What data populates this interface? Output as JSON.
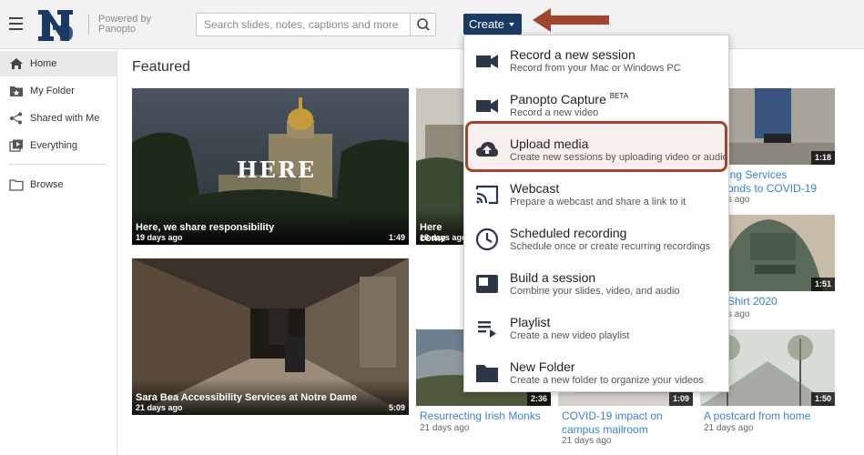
{
  "header": {
    "logo_text": "ND",
    "powered_line1": "Powered by",
    "powered_line2": "Panopto",
    "search_placeholder": "Search slides, notes, captions and more",
    "create_label": "Create"
  },
  "sidebar": {
    "items": [
      {
        "label": "Home",
        "icon": "home-icon",
        "active": true
      },
      {
        "label": "My Folder",
        "icon": "folder-star-icon"
      },
      {
        "label": "Shared with Me",
        "icon": "share-icon"
      },
      {
        "label": "Everything",
        "icon": "video-library-icon"
      },
      {
        "label": "Browse",
        "icon": "folder-icon"
      }
    ]
  },
  "main": {
    "heading": "Featured",
    "tiles": [
      {
        "title": "Here, we share responsibility",
        "ago": "19 days ago",
        "duration": "1:49",
        "overlay_text": "HERE"
      },
      {
        "title": "Here come",
        "ago": "18 days ago",
        "duration": ""
      },
      {
        "title": "Sara Bea Accessibility Services at Notre Dame",
        "ago": "21 days ago",
        "duration": "5:09"
      },
      {
        "title": "Resurrecting Irish Monks",
        "ago": "21 days ago",
        "duration": "2:36"
      },
      {
        "title": "COVID-19 impact on campus mailroom",
        "ago": "21 days ago",
        "duration": "1:09"
      },
      {
        "title": "A postcard from home",
        "ago": "21 days ago",
        "duration": "1:50"
      },
      {
        "title_line1": "ing Services",
        "title_line2": "onds to COVID-19",
        "ago": "s ago",
        "duration": "1:18"
      },
      {
        "title": "Shirt 2020",
        "ago": "s ago",
        "duration": "1:51"
      }
    ]
  },
  "create_menu": {
    "items": [
      {
        "title": "Record a new session",
        "subtitle": "Record from your Mac or Windows PC",
        "icon": "video-camera-icon"
      },
      {
        "title": "Panopto Capture",
        "badge": "BETA",
        "subtitle": "Record a new video",
        "icon": "video-camera-icon"
      },
      {
        "title": "Upload media",
        "subtitle": "Create new sessions by uploading video or audio",
        "icon": "cloud-upload-icon"
      },
      {
        "title": "Webcast",
        "subtitle": "Prepare a webcast and share a link to it",
        "icon": "cast-icon"
      },
      {
        "title": "Scheduled recording",
        "subtitle": "Schedule once or create recurring recordings",
        "icon": "clock-icon"
      },
      {
        "title": "Build a session",
        "subtitle": "Combine your slides, video, and audio",
        "icon": "layout-icon"
      },
      {
        "title": "Playlist",
        "subtitle": "Create a new video playlist",
        "icon": "playlist-icon"
      },
      {
        "title": "New Folder",
        "subtitle": "Create a new folder to organize your videos",
        "icon": "folder-icon"
      }
    ]
  },
  "colors": {
    "navy": "#1b3a63",
    "link_blue": "#3b7fd0",
    "annotation": "#a0452f"
  }
}
